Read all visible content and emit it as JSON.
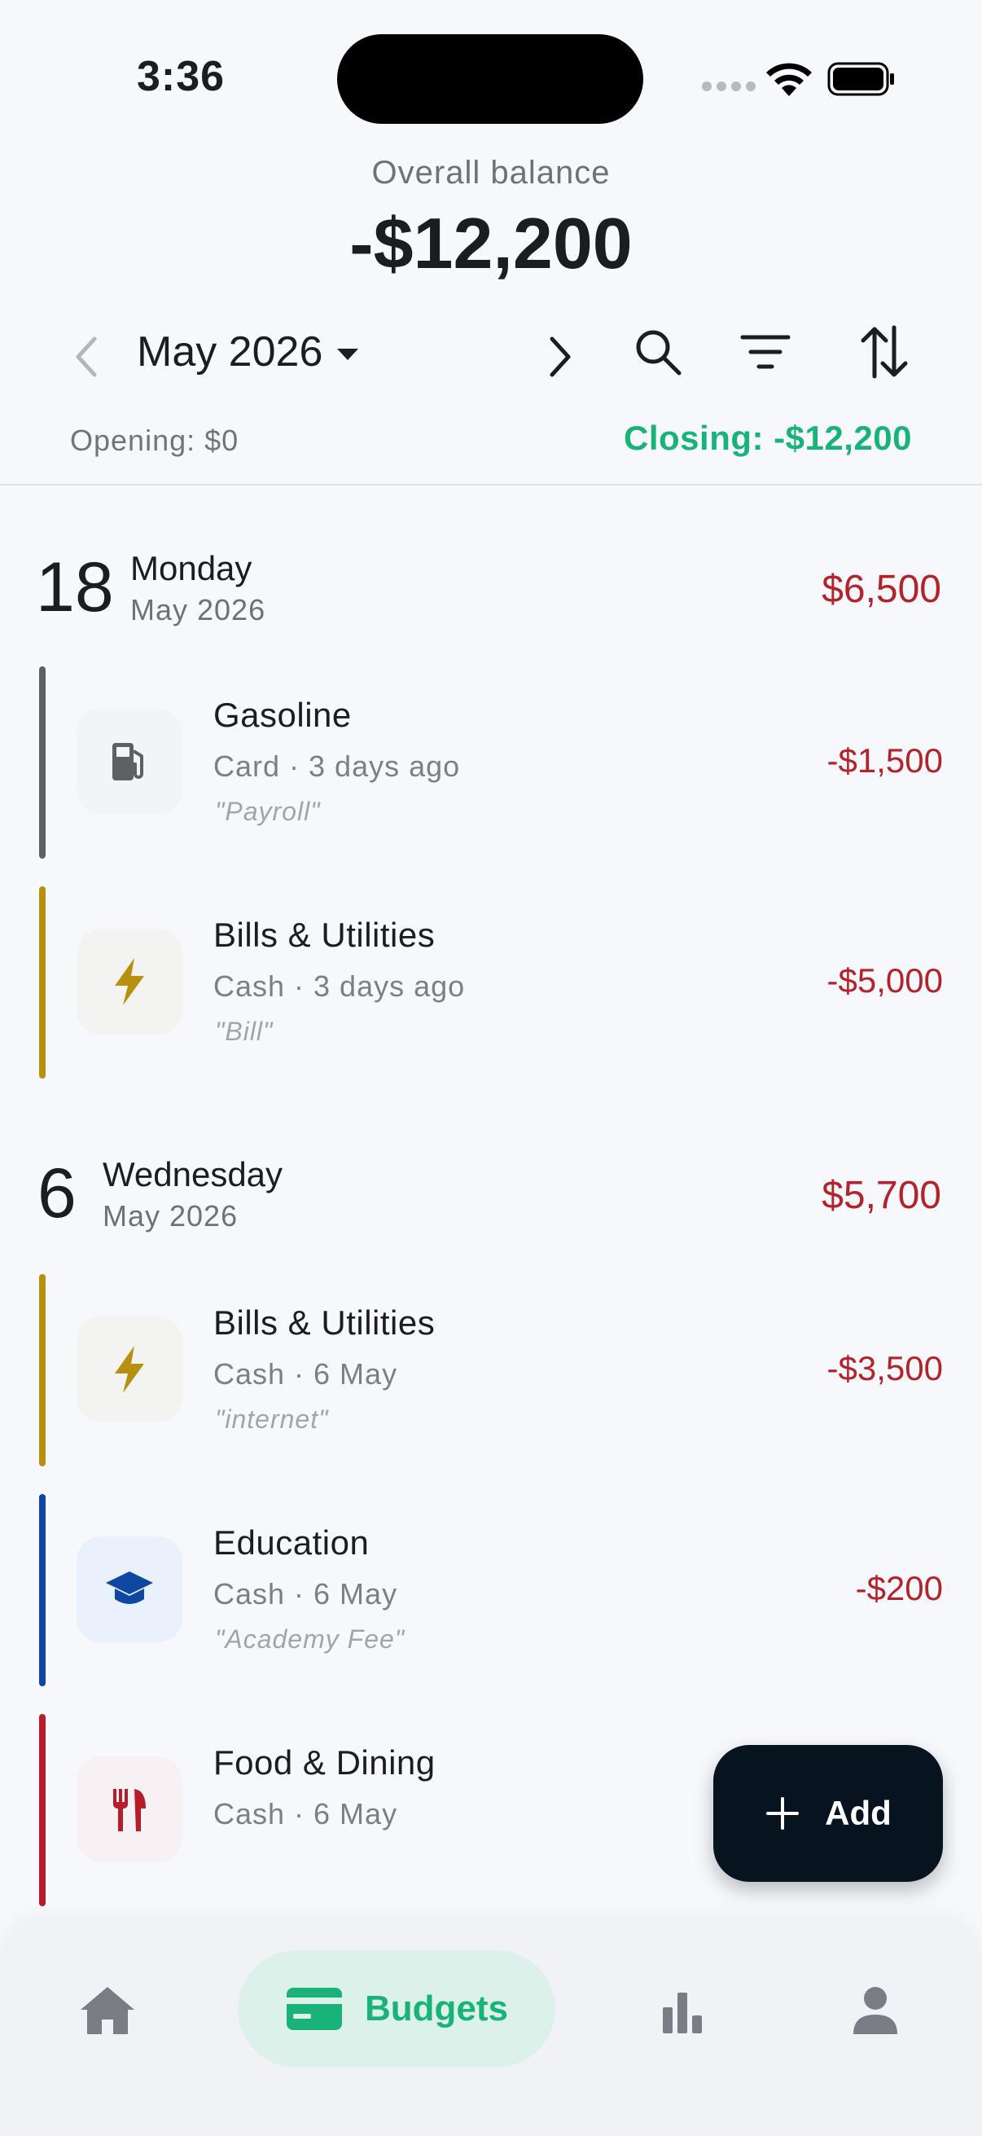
{
  "status_bar": {
    "time": "3:36"
  },
  "header": {
    "balance_label": "Overall balance",
    "balance_value": "-$12,200",
    "month": "May 2026",
    "opening": "Opening: $0",
    "closing": "Closing: -$12,200"
  },
  "days": [
    {
      "day_number": "18",
      "weekday": "Monday",
      "month": "May 2026",
      "total": "$6,500",
      "transactions": [
        {
          "title": "Gasoline",
          "meta": "Card · 3 days ago",
          "note": "\"Payroll\"",
          "amount": "-$1,500",
          "icon": "fuel-pump-icon",
          "color": "#5f6064"
        },
        {
          "title": "Bills & Utilities",
          "meta": "Cash · 3 days ago",
          "note": "\"Bill\"",
          "amount": "-$5,000",
          "icon": "lightning-icon",
          "color": "#b8900f"
        }
      ]
    },
    {
      "day_number": "6",
      "weekday": "Wednesday",
      "month": "May 2026",
      "total": "$5,700",
      "transactions": [
        {
          "title": "Bills & Utilities",
          "meta": "Cash · 6 May",
          "note": "\"internet\"",
          "amount": "-$3,500",
          "icon": "lightning-icon",
          "color": "#b8900f"
        },
        {
          "title": "Education",
          "meta": "Cash · 6 May",
          "note": "\"Academy Fee\"",
          "amount": "-$200",
          "icon": "graduation-cap-icon",
          "color": "#0d47a1"
        },
        {
          "title": "Food & Dining",
          "meta": "Cash · 6 May",
          "note": "",
          "amount": "",
          "icon": "fork-knife-icon",
          "color": "#b71c2a"
        }
      ]
    }
  ],
  "fab": {
    "label": "Add"
  },
  "bottom_nav": {
    "items": [
      {
        "name": "home",
        "icon": "home-icon"
      },
      {
        "name": "budgets",
        "icon": "wallet-icon",
        "label": "Budgets",
        "active": true
      },
      {
        "name": "stats",
        "icon": "bar-chart-icon"
      },
      {
        "name": "profile",
        "icon": "person-icon"
      }
    ]
  },
  "colors": {
    "accent": "#19b37a",
    "negative": "#b3232b",
    "fab": "#07131f"
  }
}
